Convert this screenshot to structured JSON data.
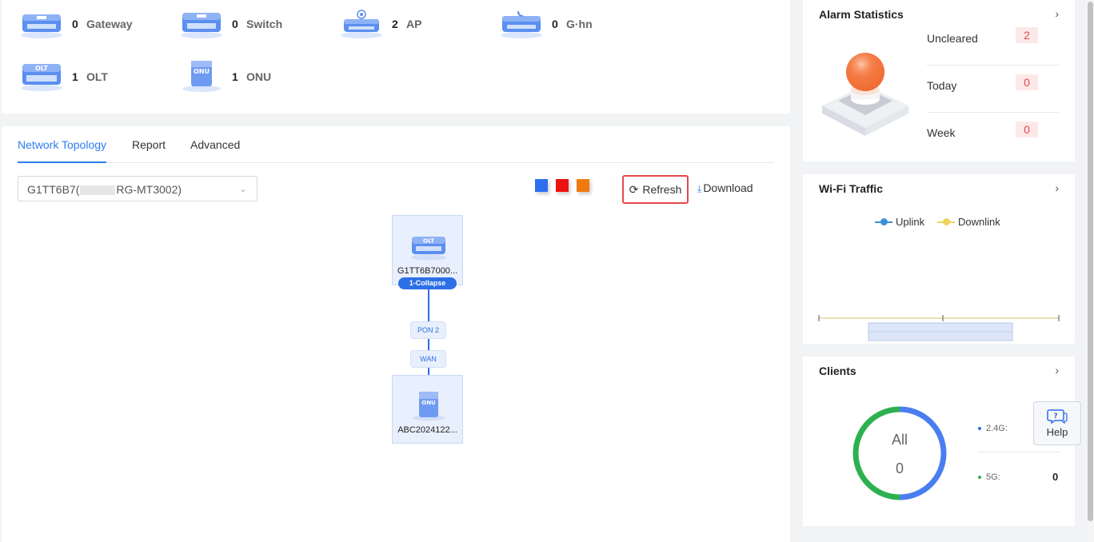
{
  "devices": [
    {
      "icon": "gateway-icon",
      "count": "0",
      "name": "Gateway"
    },
    {
      "icon": "switch-icon",
      "count": "0",
      "name": "Switch"
    },
    {
      "icon": "ap-icon",
      "count": "2",
      "name": "AP"
    },
    {
      "icon": "ghn-icon",
      "count": "0",
      "name": "G·hn"
    },
    {
      "icon": "olt-icon",
      "count": "1",
      "name": "OLT"
    },
    {
      "icon": "onu-icon",
      "count": "1",
      "name": "ONU"
    }
  ],
  "tabs": [
    "Network Topology",
    "Report",
    "Advanced"
  ],
  "active_tab": "Network Topology",
  "device_select": {
    "prefix": "G1TT6B7(",
    "suffix": "RG-MT3002)"
  },
  "legend_colors": [
    "#2d6ff0",
    "#ee1111",
    "#f07a10"
  ],
  "toolbar": {
    "refresh_label": "Refresh",
    "download_label": "Download"
  },
  "topology": {
    "root": {
      "name": "G1TT6B7000...",
      "icon_text": "OLT",
      "collapse_label": "1-Collapse"
    },
    "ports": [
      "PON 2",
      "WAN"
    ],
    "child": {
      "name": "ABC2024122...",
      "icon_text": "ONU"
    }
  },
  "alarm": {
    "title": "Alarm Statistics",
    "rows": [
      {
        "label": "Uncleared",
        "value": "2"
      },
      {
        "label": "Today",
        "value": "0"
      },
      {
        "label": "Week",
        "value": "0"
      }
    ]
  },
  "wifi": {
    "title": "Wi-Fi Traffic",
    "legend": [
      {
        "name": "Uplink",
        "color": "#3d8fd6"
      },
      {
        "name": "Downlink",
        "color": "#f0d35a"
      }
    ]
  },
  "clients": {
    "title": "Clients",
    "all_label": "All",
    "all_value": "0",
    "bands": [
      {
        "label": "2.4G:",
        "value": "",
        "color": "#2d6ff0"
      },
      {
        "label": "5G:",
        "value": "0",
        "color": "#2db14f"
      }
    ]
  },
  "help_label": "Help",
  "accent_color": "#2d7df0"
}
